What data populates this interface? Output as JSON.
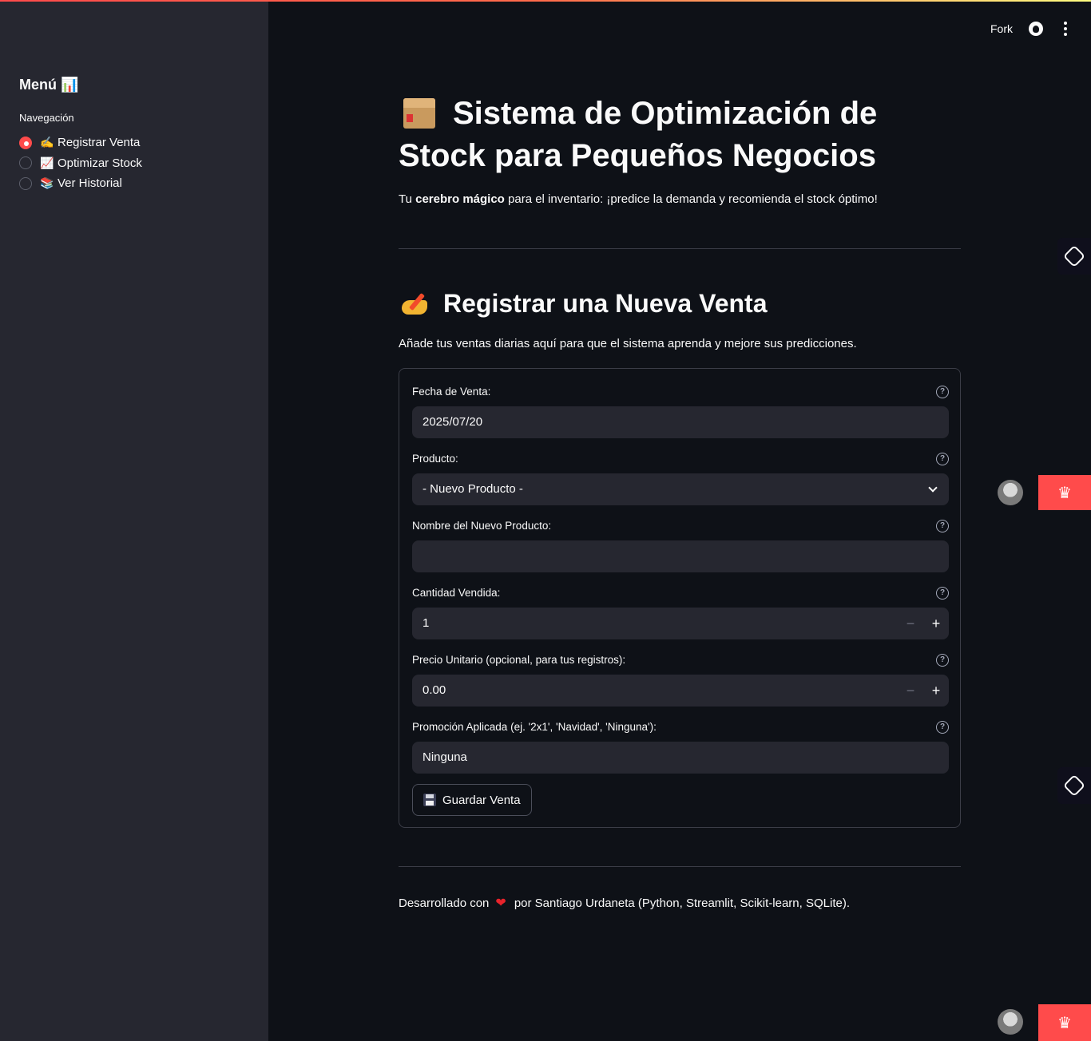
{
  "sidebar": {
    "title": "Menú 📊",
    "nav_label": "Navegación",
    "items": [
      {
        "emoji": "✍️",
        "label": "Registrar Venta",
        "selected": true
      },
      {
        "emoji": "📈",
        "label": "Optimizar Stock",
        "selected": false
      },
      {
        "emoji": "📚",
        "label": "Ver Historial",
        "selected": false
      }
    ]
  },
  "topbar": {
    "fork_label": "Fork",
    "github_icon": "github-icon",
    "menu_icon": "kebab-menu-icon"
  },
  "header": {
    "title": "Sistema de Optimización de Stock para Pequeños Negocios",
    "subtitle_pre": "Tu ",
    "subtitle_bold": "cerebro mágico",
    "subtitle_post": " para el inventario: ¡predice la demanda y recomienda el stock óptimo!"
  },
  "section": {
    "title": "Registrar una Nueva Venta",
    "description": "Añade tus ventas diarias aquí para que el sistema aprenda y mejore sus predicciones."
  },
  "form": {
    "date": {
      "label": "Fecha de Venta:",
      "value": "2025/07/20"
    },
    "product": {
      "label": "Producto:",
      "value": "- Nuevo Producto -"
    },
    "new_product": {
      "label": "Nombre del Nuevo Producto:",
      "value": ""
    },
    "quantity": {
      "label": "Cantidad Vendida:",
      "value": "1"
    },
    "price": {
      "label": "Precio Unitario (opcional, para tus registros):",
      "value": "0.00"
    },
    "promotion": {
      "label": "Promoción Aplicada (ej. '2x1', 'Navidad', 'Ninguna'):",
      "value": "Ninguna"
    },
    "submit_label": "Guardar Venta",
    "help_glyph": "?",
    "minus_glyph": "−",
    "plus_glyph": "+"
  },
  "footer": {
    "pre": "Desarrollado con",
    "heart": "❤",
    "post": "por Santiago Urdaneta (Python, Streamlit, Scikit-learn, SQLite)."
  },
  "accent_color": "#ff4b4b"
}
